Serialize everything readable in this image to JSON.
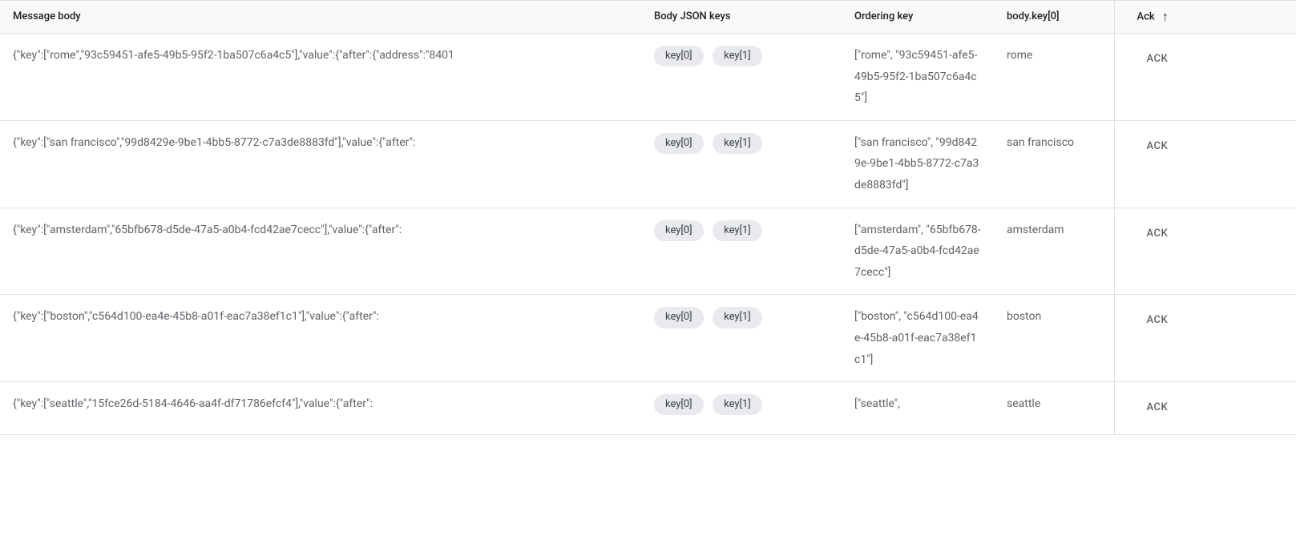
{
  "headers": {
    "message_body": "Message body",
    "body_json_keys": "Body JSON keys",
    "ordering_key": "Ordering key",
    "body_key0": "body.key[0]",
    "ack": "Ack"
  },
  "chips": {
    "key0": "key[0]",
    "key1": "key[1]"
  },
  "ack_label": "ACK",
  "sort_arrow": "↑",
  "rows": [
    {
      "body": "{\"key\":[\"rome\",\"93c59451-afe5-49b5-95f2-1ba507c6a4c5\"],\"value\":{\"after\":{\"address\":\"8401",
      "ordering": "[\"rome\", \"93c59451-afe5-49b5-95f2-1ba507c6a4c5\"]",
      "key0": "rome"
    },
    {
      "body": "{\"key\":[\"san francisco\",\"99d8429e-9be1-4bb5-8772-c7a3de8883fd\"],\"value\":{\"after\":",
      "ordering": "[\"san francisco\", \"99d8429e-9be1-4bb5-8772-c7a3de8883fd\"]",
      "key0": "san francisco"
    },
    {
      "body": "{\"key\":[\"amsterdam\",\"65bfb678-d5de-47a5-a0b4-fcd42ae7cecc\"],\"value\":{\"after\":",
      "ordering": "[\"amsterdam\", \"65bfb678-d5de-47a5-a0b4-fcd42ae7cecc\"]",
      "key0": "amsterdam"
    },
    {
      "body": "{\"key\":[\"boston\",\"c564d100-ea4e-45b8-a01f-eac7a38ef1c1\"],\"value\":{\"after\":",
      "ordering": "[\"boston\", \"c564d100-ea4e-45b8-a01f-eac7a38ef1c1\"]",
      "key0": "boston"
    },
    {
      "body": "{\"key\":[\"seattle\",\"15fce26d-5184-4646-aa4f-df71786efcf4\"],\"value\":{\"after\":",
      "ordering": "[\"seattle\",",
      "key0": "seattle"
    }
  ]
}
